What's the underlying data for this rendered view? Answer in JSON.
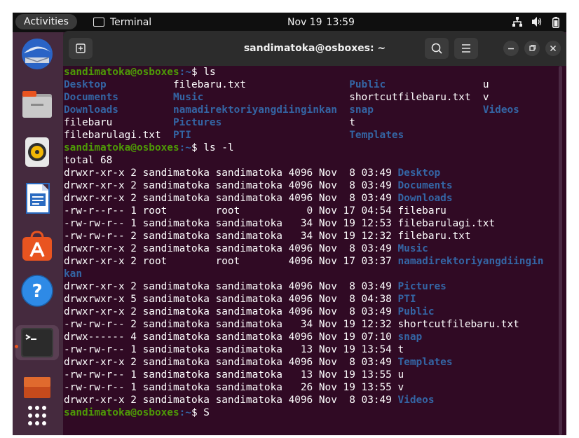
{
  "topbar": {
    "activities": "Activities",
    "app_name": "Terminal",
    "date": "Nov 19",
    "time": "13:59"
  },
  "window": {
    "title": "sandimatoka@osboxes: ~"
  },
  "terminal": {
    "prompt_user": "sandimatoka@osboxes",
    "prompt_path": ":~",
    "cmd1": "$ ls",
    "ls_rows": [
      [
        {
          "t": "Desktop",
          "c": "d"
        },
        {
          "t": "filebaru.txt",
          "c": "n"
        },
        {
          "t": "Public",
          "c": "d"
        },
        {
          "t": "u",
          "c": "n"
        }
      ],
      [
        {
          "t": "Documents",
          "c": "d"
        },
        {
          "t": "Music",
          "c": "d"
        },
        {
          "t": "shortcutfilebaru.txt",
          "c": "n"
        },
        {
          "t": "v",
          "c": "n"
        }
      ],
      [
        {
          "t": "Downloads",
          "c": "d"
        },
        {
          "t": "namadirektoriyangdiinginkan",
          "c": "d"
        },
        {
          "t": "snap",
          "c": "d"
        },
        {
          "t": "Videos",
          "c": "d"
        }
      ],
      [
        {
          "t": "filebaru",
          "c": "n"
        },
        {
          "t": "Pictures",
          "c": "d"
        },
        {
          "t": "t",
          "c": "n"
        },
        {
          "t": "",
          "c": "n"
        }
      ],
      [
        {
          "t": "filebarulagi.txt",
          "c": "n"
        },
        {
          "t": "PTI",
          "c": "d"
        },
        {
          "t": "Templates",
          "c": "d"
        },
        {
          "t": "",
          "c": "n"
        }
      ]
    ],
    "cmd2": "$ ls -l",
    "total": "total 68",
    "ll_rows": [
      {
        "meta": "drwxr-xr-x 2 sandimatoka sandimatoka 4096 Nov  8 03:49 ",
        "name": "Desktop",
        "c": "d"
      },
      {
        "meta": "drwxr-xr-x 2 sandimatoka sandimatoka 4096 Nov  8 03:49 ",
        "name": "Documents",
        "c": "d"
      },
      {
        "meta": "drwxr-xr-x 2 sandimatoka sandimatoka 4096 Nov  8 03:49 ",
        "name": "Downloads",
        "c": "d"
      },
      {
        "meta": "-rw-r--r-- 1 root        root           0 Nov 17 04:54 ",
        "name": "filebaru",
        "c": "n"
      },
      {
        "meta": "-rw-rw-r-- 1 sandimatoka sandimatoka   34 Nov 19 12:53 ",
        "name": "filebarulagi.txt",
        "c": "n"
      },
      {
        "meta": "-rw-rw-r-- 2 sandimatoka sandimatoka   34 Nov 19 12:32 ",
        "name": "filebaru.txt",
        "c": "n"
      },
      {
        "meta": "drwxr-xr-x 2 sandimatoka sandimatoka 4096 Nov  8 03:49 ",
        "name": "Music",
        "c": "d"
      },
      {
        "meta": "drwxr-xr-x 2 root        root        4096 Nov 17 03:37 ",
        "name": "namadirektoriyangdiingin",
        "c": "d"
      },
      {
        "meta": "",
        "name": "kan",
        "c": "d"
      },
      {
        "meta": "drwxr-xr-x 2 sandimatoka sandimatoka 4096 Nov  8 03:49 ",
        "name": "Pictures",
        "c": "d"
      },
      {
        "meta": "drwxrwxr-x 5 sandimatoka sandimatoka 4096 Nov  8 04:38 ",
        "name": "PTI",
        "c": "d"
      },
      {
        "meta": "drwxr-xr-x 2 sandimatoka sandimatoka 4096 Nov  8 03:49 ",
        "name": "Public",
        "c": "d"
      },
      {
        "meta": "-rw-rw-r-- 2 sandimatoka sandimatoka   34 Nov 19 12:32 ",
        "name": "shortcutfilebaru.txt",
        "c": "n"
      },
      {
        "meta": "drwx------ 4 sandimatoka sandimatoka 4096 Nov 19 07:10 ",
        "name": "snap",
        "c": "d"
      },
      {
        "meta": "-rw-rw-r-- 1 sandimatoka sandimatoka   13 Nov 19 13:54 ",
        "name": "t",
        "c": "n"
      },
      {
        "meta": "drwxr-xr-x 2 sandimatoka sandimatoka 4096 Nov  8 03:49 ",
        "name": "Templates",
        "c": "d"
      },
      {
        "meta": "-rw-rw-r-- 1 sandimatoka sandimatoka   13 Nov 19 13:55 ",
        "name": "u",
        "c": "n"
      },
      {
        "meta": "-rw-rw-r-- 1 sandimatoka sandimatoka   26 Nov 19 13:55 ",
        "name": "v",
        "c": "n"
      },
      {
        "meta": "drwxr-xr-x 2 sandimatoka sandimatoka 4096 Nov  8 03:49 ",
        "name": "Videos",
        "c": "d"
      }
    ],
    "cmd3": "$ S"
  },
  "colors": {
    "terminal_bg": "#300a24",
    "prompt_green": "#4e9a06",
    "dir_blue": "#3465a4",
    "ubuntu_orange": "#e95420"
  },
  "dock": {
    "icons": [
      "thunderbird-icon",
      "files-icon",
      "rhythmbox-icon",
      "writer-icon",
      "app-center-icon",
      "help-icon",
      "terminal-icon",
      "usb-creator-icon",
      "show-apps-icon"
    ]
  }
}
